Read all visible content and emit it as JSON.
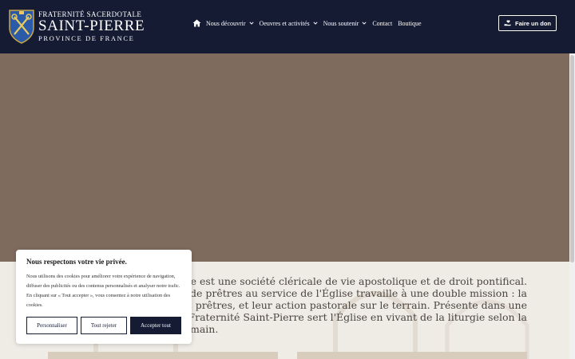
{
  "header": {
    "logo": {
      "line1": "FRATERNITÉ SACERDOTALE",
      "line2": "SAINT-PIERRE",
      "line3": "PROVINCE DE FRANCE"
    },
    "nav": [
      {
        "label": "Nous découvrir",
        "dropdown": true
      },
      {
        "label": "Oeuvres et activités",
        "dropdown": true
      },
      {
        "label": "Nous soutenir",
        "dropdown": true
      },
      {
        "label": "Contact",
        "dropdown": false
      },
      {
        "label": "Boutique",
        "dropdown": false
      }
    ],
    "donate_label": "Faire un don"
  },
  "content": {
    "paragraph_lines": [
      "-Pierre est une société cléricale de vie apostolique et de droit pontifical.",
      "nauté de prêtres au service de l'Église travaille à une double mission : la",
      "des prêtres, et leur action pastorale sur le terrain. Présente dans une",
      "ance, la Fraternité Saint-Pierre sert l'Église en vivant de la liturgie selon la",
      "main."
    ]
  },
  "cookie": {
    "title": "Nous respectons votre vie privée.",
    "text": "Nous utilisons des cookies pour améliorer votre expérience de navigation, diffuser des publicités ou des contenus personnalisés et analyser notre trafic. En cliquant sur « Tout accepter », vous consentez à notre utilisation des cookies.",
    "buttons": {
      "customize": "Personnaliser",
      "reject": "Tout rejeter",
      "accept": "Accepter tout"
    }
  },
  "colors": {
    "header_bg": "#141b33",
    "hero_bg": "#7e6b5e",
    "content_bg": "#efebe5",
    "accent": "#141b33"
  }
}
